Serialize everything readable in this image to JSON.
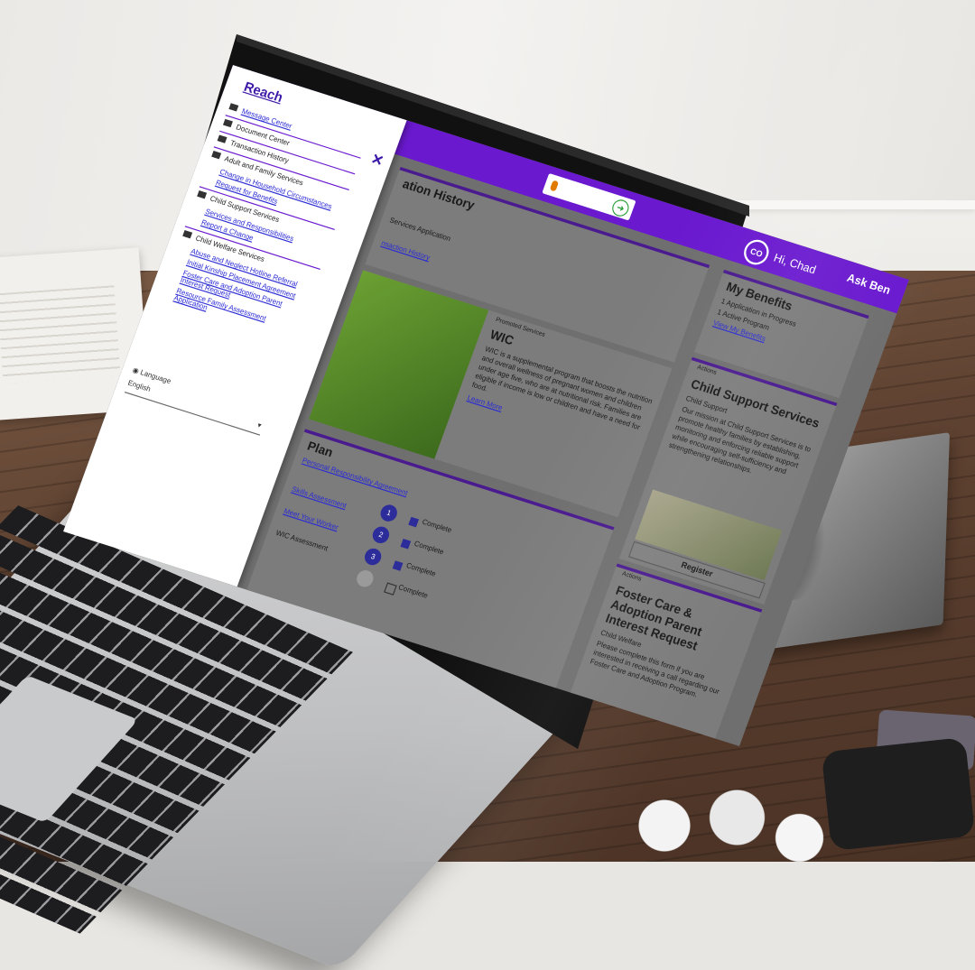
{
  "app": {
    "brand": "Reach",
    "ask": "Ask Ben",
    "user_initials": "CO",
    "user_greeting": "Hi, Chad"
  },
  "drawer": {
    "items": [
      {
        "label": "Message Center",
        "type": "active"
      },
      {
        "label": "Document Center",
        "type": "section"
      },
      {
        "label": "Transaction History",
        "type": "section"
      },
      {
        "label": "Adult and Family Services",
        "type": "section"
      },
      {
        "label": "Change in Household Circumstances",
        "type": "link"
      },
      {
        "label": "Request for Benefits",
        "type": "link"
      },
      {
        "label": "Child Support Services",
        "type": "section"
      },
      {
        "label": "Services and Responsibilities",
        "type": "link"
      },
      {
        "label": "Report a Change",
        "type": "link"
      },
      {
        "label": "Child Welfare Services",
        "type": "section"
      },
      {
        "label": "Abuse and Neglect Hotline Referral",
        "type": "link"
      },
      {
        "label": "Initial Kinship Placement Agreement",
        "type": "link"
      },
      {
        "label": "Foster Care and Adoption Parent Interest Request",
        "type": "link"
      },
      {
        "label": "Resource Family Assessment Application",
        "type": "link"
      }
    ],
    "language_label": "Language",
    "language_value": "English"
  },
  "main": {
    "history_title": "ation History",
    "history_line": "Services Application",
    "history_link": "nsaction History",
    "wic": {
      "kicker": "Promoted Services",
      "title": "WIC",
      "body": "WIC is a supplemental program that boosts the nutrition and overall wellness of pregnant women and children under age five, who are at nutritional risk. Families are eligible if income is low or children and have a need for food.",
      "link": "Learn More"
    },
    "plan": {
      "title": "Plan",
      "subtitle": "Personal Responsibility Agreement",
      "steps": [
        {
          "label": "Skills Assessment",
          "status": "Complete"
        },
        {
          "label": "Meet Your Worker",
          "status": "Complete"
        },
        {
          "label": "WIC Assessment",
          "status": "Complete"
        },
        {
          "label": "",
          "status": "Complete"
        }
      ]
    },
    "benefits": {
      "title": "My Benefits",
      "line1": "1 Application in Progress",
      "line2": "1 Active Program",
      "link": "View My Benefits"
    },
    "child_support": {
      "kicker": "Actions",
      "title": "Child Support Services",
      "sub": "Child Support",
      "body": "Our mission at Child Support Services is to promote healthy families by establishing, monitoring and enforcing reliable support while encouraging self-sufficiency and strengthening relationships.",
      "button": "Register"
    },
    "foster": {
      "kicker": "Actions",
      "title": "Foster Care & Adoption Parent Interest Request",
      "sub": "Child Welfare",
      "body": "Please complete this form if you are interested in receiving a call regarding our Foster Care and Adoption Program."
    }
  }
}
